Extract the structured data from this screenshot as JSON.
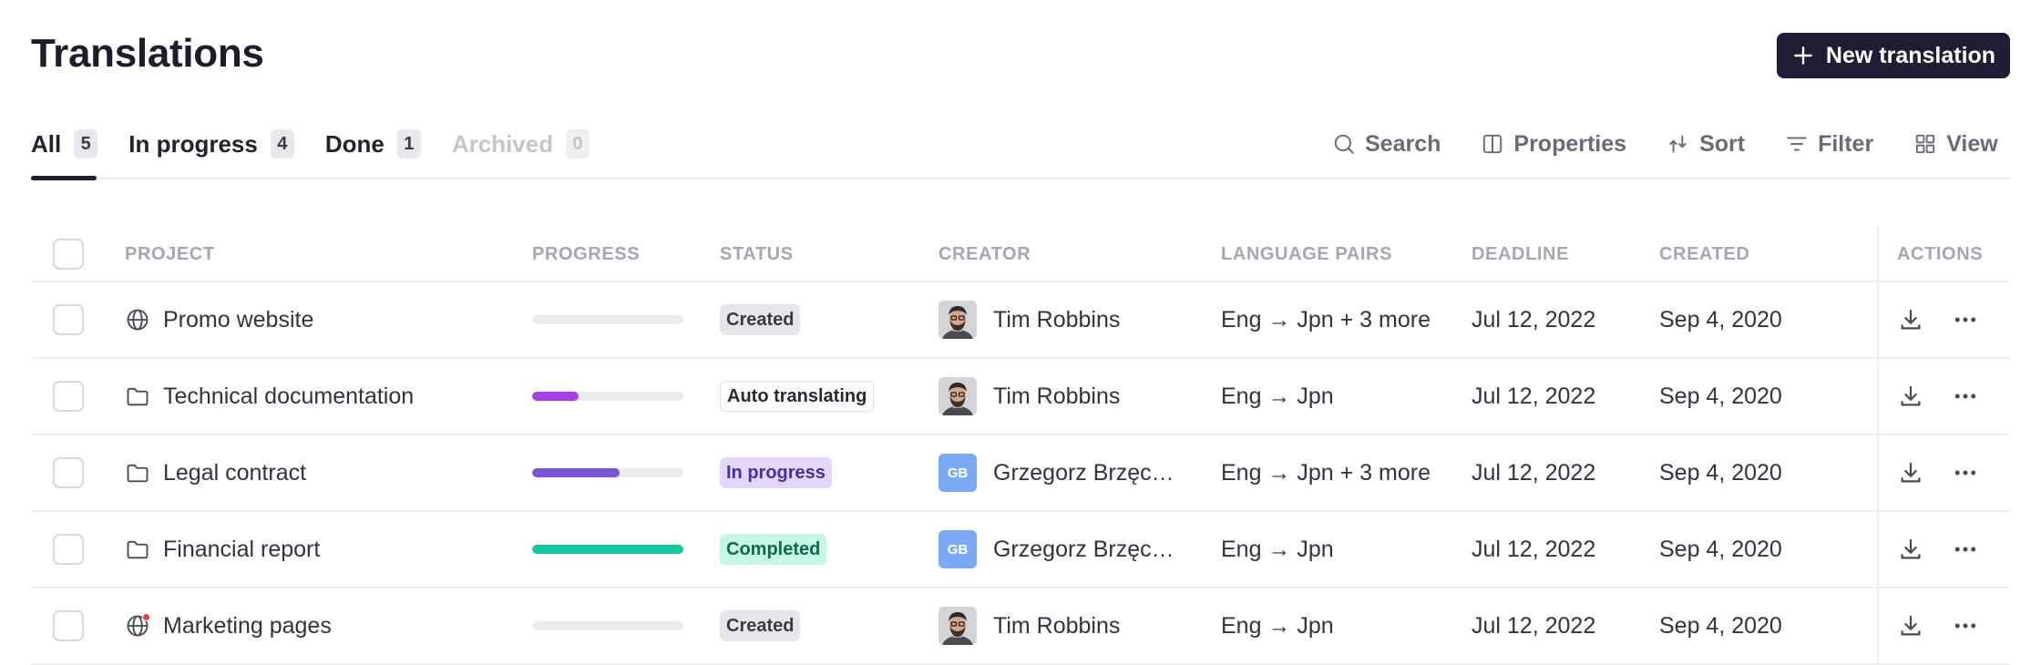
{
  "header": {
    "title": "Translations",
    "new_button_label": "New translation"
  },
  "tabs": [
    {
      "label": "All",
      "count": "5",
      "active": true
    },
    {
      "label": "In progress",
      "count": "4"
    },
    {
      "label": "Done",
      "count": "1"
    },
    {
      "label": "Archived",
      "count": "0",
      "disabled": true
    }
  ],
  "tools": {
    "search": "Search",
    "properties": "Properties",
    "sort": "Sort",
    "filter": "Filter",
    "view": "View"
  },
  "table": {
    "columns": {
      "project": "Project",
      "progress": "Progress",
      "status": "Status",
      "creator": "Creator",
      "language_pairs": "Language pairs",
      "deadline": "Deadline",
      "created": "Created",
      "actions": "Actions"
    },
    "rows": [
      {
        "project": "Promo website",
        "icon": "globe-icon",
        "progress": 0,
        "status": "Created",
        "status_kind": "created",
        "creator": "Tim Robbins",
        "avatar": "photo",
        "language_pairs": "Eng → Jpn + 3 more",
        "deadline": "Jul 12, 2022",
        "created": "Sep 4, 2020"
      },
      {
        "project": "Technical documentation",
        "icon": "folder-icon",
        "progress": 0.31,
        "progress_color": "#a83ee8",
        "status": "Auto translating",
        "status_kind": "auto",
        "creator": "Tim Robbins",
        "avatar": "photo",
        "language_pairs": "Eng → Jpn",
        "deadline": "Jul 12, 2022",
        "created": "Sep 4, 2020"
      },
      {
        "project": "Legal contract",
        "icon": "folder-icon",
        "progress": 0.58,
        "progress_color": "#7a56d6",
        "status": "In progress",
        "status_kind": "inprogress",
        "creator": "Grzegorz Brzęczyszczykiewicz",
        "avatar": "initials",
        "initials": "GB",
        "language_pairs": "Eng → Jpn + 3 more",
        "deadline": "Jul 12, 2022",
        "created": "Sep 4, 2020"
      },
      {
        "project": "Financial report",
        "icon": "folder-icon",
        "progress": 1,
        "progress_color": "#13c6a2",
        "status": "Completed",
        "status_kind": "completed",
        "creator": "Grzegorz Brzęczyszczykiewicz",
        "avatar": "initials",
        "initials": "GB",
        "language_pairs": "Eng → Jpn",
        "deadline": "Jul 12, 2022",
        "created": "Sep 4, 2020"
      },
      {
        "project": "Marketing pages",
        "icon": "globe-notification-icon",
        "progress": 0,
        "status": "Created",
        "status_kind": "created",
        "creator": "Tim Robbins",
        "avatar": "photo",
        "language_pairs": "Eng → Jpn",
        "deadline": "Jul 12, 2022",
        "created": "Sep 4, 2020"
      }
    ]
  },
  "colors": {
    "primary": "#1e1d33",
    "notification_dot": "#ef3b4a"
  }
}
